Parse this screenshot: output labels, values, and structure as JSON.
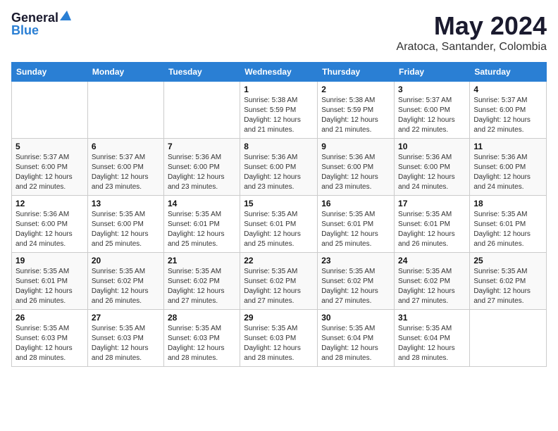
{
  "logo": {
    "general": "General",
    "blue": "Blue"
  },
  "header": {
    "month": "May 2024",
    "location": "Aratoca, Santander, Colombia"
  },
  "weekdays": [
    "Sunday",
    "Monday",
    "Tuesday",
    "Wednesday",
    "Thursday",
    "Friday",
    "Saturday"
  ],
  "weeks": [
    [
      {
        "day": "",
        "info": ""
      },
      {
        "day": "",
        "info": ""
      },
      {
        "day": "",
        "info": ""
      },
      {
        "day": "1",
        "info": "Sunrise: 5:38 AM\nSunset: 5:59 PM\nDaylight: 12 hours\nand 21 minutes."
      },
      {
        "day": "2",
        "info": "Sunrise: 5:38 AM\nSunset: 5:59 PM\nDaylight: 12 hours\nand 21 minutes."
      },
      {
        "day": "3",
        "info": "Sunrise: 5:37 AM\nSunset: 6:00 PM\nDaylight: 12 hours\nand 22 minutes."
      },
      {
        "day": "4",
        "info": "Sunrise: 5:37 AM\nSunset: 6:00 PM\nDaylight: 12 hours\nand 22 minutes."
      }
    ],
    [
      {
        "day": "5",
        "info": "Sunrise: 5:37 AM\nSunset: 6:00 PM\nDaylight: 12 hours\nand 22 minutes."
      },
      {
        "day": "6",
        "info": "Sunrise: 5:37 AM\nSunset: 6:00 PM\nDaylight: 12 hours\nand 23 minutes."
      },
      {
        "day": "7",
        "info": "Sunrise: 5:36 AM\nSunset: 6:00 PM\nDaylight: 12 hours\nand 23 minutes."
      },
      {
        "day": "8",
        "info": "Sunrise: 5:36 AM\nSunset: 6:00 PM\nDaylight: 12 hours\nand 23 minutes."
      },
      {
        "day": "9",
        "info": "Sunrise: 5:36 AM\nSunset: 6:00 PM\nDaylight: 12 hours\nand 23 minutes."
      },
      {
        "day": "10",
        "info": "Sunrise: 5:36 AM\nSunset: 6:00 PM\nDaylight: 12 hours\nand 24 minutes."
      },
      {
        "day": "11",
        "info": "Sunrise: 5:36 AM\nSunset: 6:00 PM\nDaylight: 12 hours\nand 24 minutes."
      }
    ],
    [
      {
        "day": "12",
        "info": "Sunrise: 5:36 AM\nSunset: 6:00 PM\nDaylight: 12 hours\nand 24 minutes."
      },
      {
        "day": "13",
        "info": "Sunrise: 5:35 AM\nSunset: 6:00 PM\nDaylight: 12 hours\nand 25 minutes."
      },
      {
        "day": "14",
        "info": "Sunrise: 5:35 AM\nSunset: 6:01 PM\nDaylight: 12 hours\nand 25 minutes."
      },
      {
        "day": "15",
        "info": "Sunrise: 5:35 AM\nSunset: 6:01 PM\nDaylight: 12 hours\nand 25 minutes."
      },
      {
        "day": "16",
        "info": "Sunrise: 5:35 AM\nSunset: 6:01 PM\nDaylight: 12 hours\nand 25 minutes."
      },
      {
        "day": "17",
        "info": "Sunrise: 5:35 AM\nSunset: 6:01 PM\nDaylight: 12 hours\nand 26 minutes."
      },
      {
        "day": "18",
        "info": "Sunrise: 5:35 AM\nSunset: 6:01 PM\nDaylight: 12 hours\nand 26 minutes."
      }
    ],
    [
      {
        "day": "19",
        "info": "Sunrise: 5:35 AM\nSunset: 6:01 PM\nDaylight: 12 hours\nand 26 minutes."
      },
      {
        "day": "20",
        "info": "Sunrise: 5:35 AM\nSunset: 6:02 PM\nDaylight: 12 hours\nand 26 minutes."
      },
      {
        "day": "21",
        "info": "Sunrise: 5:35 AM\nSunset: 6:02 PM\nDaylight: 12 hours\nand 27 minutes."
      },
      {
        "day": "22",
        "info": "Sunrise: 5:35 AM\nSunset: 6:02 PM\nDaylight: 12 hours\nand 27 minutes."
      },
      {
        "day": "23",
        "info": "Sunrise: 5:35 AM\nSunset: 6:02 PM\nDaylight: 12 hours\nand 27 minutes."
      },
      {
        "day": "24",
        "info": "Sunrise: 5:35 AM\nSunset: 6:02 PM\nDaylight: 12 hours\nand 27 minutes."
      },
      {
        "day": "25",
        "info": "Sunrise: 5:35 AM\nSunset: 6:02 PM\nDaylight: 12 hours\nand 27 minutes."
      }
    ],
    [
      {
        "day": "26",
        "info": "Sunrise: 5:35 AM\nSunset: 6:03 PM\nDaylight: 12 hours\nand 28 minutes."
      },
      {
        "day": "27",
        "info": "Sunrise: 5:35 AM\nSunset: 6:03 PM\nDaylight: 12 hours\nand 28 minutes."
      },
      {
        "day": "28",
        "info": "Sunrise: 5:35 AM\nSunset: 6:03 PM\nDaylight: 12 hours\nand 28 minutes."
      },
      {
        "day": "29",
        "info": "Sunrise: 5:35 AM\nSunset: 6:03 PM\nDaylight: 12 hours\nand 28 minutes."
      },
      {
        "day": "30",
        "info": "Sunrise: 5:35 AM\nSunset: 6:04 PM\nDaylight: 12 hours\nand 28 minutes."
      },
      {
        "day": "31",
        "info": "Sunrise: 5:35 AM\nSunset: 6:04 PM\nDaylight: 12 hours\nand 28 minutes."
      },
      {
        "day": "",
        "info": ""
      }
    ]
  ]
}
